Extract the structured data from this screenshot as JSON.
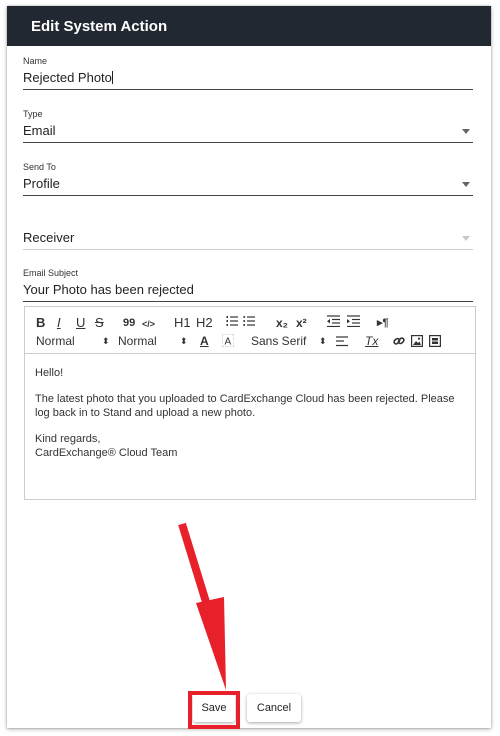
{
  "dialog": {
    "title": "Edit System Action"
  },
  "fields": {
    "name": {
      "label": "Name",
      "value": "Rejected Photo"
    },
    "type": {
      "label": "Type",
      "value": "Email"
    },
    "send_to": {
      "label": "Send To",
      "value": "Profile"
    },
    "receiver": {
      "value": "Receiver"
    },
    "email_subject": {
      "label": "Email Subject",
      "value": "Your Photo has been rejected"
    }
  },
  "toolbar": {
    "bold": "B",
    "italic": "I",
    "underline": "U",
    "strike": "S",
    "quote": "99",
    "code": "</>",
    "h1": "H1",
    "h2": "H2",
    "sub": "x₂",
    "sup": "x²",
    "rtl": "▸¶",
    "size1": "Normal",
    "size2": "Normal",
    "font": "Sans Serif",
    "color": "A",
    "clear": "Tx"
  },
  "body": {
    "greeting": "Hello!",
    "message": "The latest photo that you uploaded to CardExchange Cloud has been rejected. Please log back in to Stand and upload a new photo.",
    "closing": "Kind regards,",
    "signature": "CardExchange® Cloud Team"
  },
  "actions": {
    "save": "Save",
    "cancel": "Cancel"
  },
  "colors": {
    "header": "#222831",
    "highlight": "#e8202a"
  },
  "icons": [
    "bold-icon",
    "italic-icon",
    "underline-icon",
    "strikethrough-icon",
    "blockquote-icon",
    "code-icon",
    "ordered-list-icon",
    "bullet-list-icon",
    "subscript-icon",
    "superscript-icon",
    "outdent-icon",
    "indent-icon",
    "text-direction-icon",
    "text-color-icon",
    "background-color-icon",
    "align-icon",
    "clear-format-icon",
    "link-icon",
    "image-icon",
    "video-icon",
    "chevron-down-icon",
    "arrow-annotation"
  ]
}
